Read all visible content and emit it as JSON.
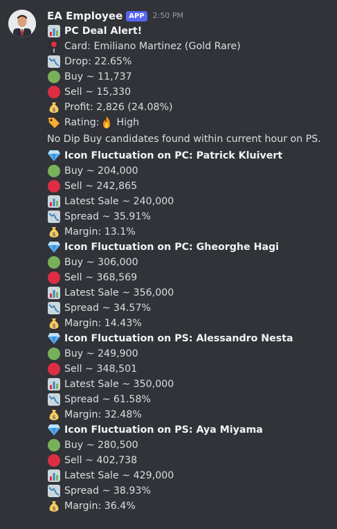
{
  "author": {
    "name": "EA Employee",
    "badge": "APP",
    "time": "2:50 PM"
  },
  "deal": {
    "title": "PC Deal Alert!",
    "lines": [
      {
        "icon": "pin-icon",
        "text": "Card: Emiliano Martinez (Gold Rare)"
      },
      {
        "icon": "chart-down-icon",
        "text": "Drop: 22.65%"
      },
      {
        "icon": "green-circle-icon",
        "text": "Buy ~ 11,737"
      },
      {
        "icon": "red-circle-icon",
        "text": "Sell ~ 15,330"
      },
      {
        "icon": "money-bag-icon",
        "text": "Profit: 2,826 (24.08%)"
      },
      {
        "icon": "tag-icon",
        "text": "Rating: ",
        "extra_icon": "fire-icon",
        "extra_text": " High"
      }
    ]
  },
  "note": "No Dip Buy candidates found within current hour on PS.",
  "fluctuations": [
    {
      "title": "Icon Fluctuation on PC: Patrick Kluivert",
      "buy": "Buy ~ 204,000",
      "sell": "Sell ~ 242,865",
      "latest": "Latest Sale ~ 240,000",
      "spread": "Spread ~ 35.91%",
      "margin": "Margin: 13.1%"
    },
    {
      "title": "Icon Fluctuation on PC: Gheorghe Hagi",
      "buy": "Buy ~ 306,000",
      "sell": "Sell ~ 368,569",
      "latest": "Latest Sale ~ 356,000",
      "spread": "Spread ~ 34.57%",
      "margin": "Margin: 14.43%"
    },
    {
      "title": "Icon Fluctuation on PS: Alessandro Nesta",
      "buy": "Buy ~ 249,900",
      "sell": "Sell ~ 348,501",
      "latest": "Latest Sale ~ 350,000",
      "spread": "Spread ~ 61.58%",
      "margin": "Margin: 32.48%"
    },
    {
      "title": "Icon Fluctuation on PS: Aya Miyama",
      "buy": "Buy ~ 280,500",
      "sell": "Sell ~ 402,738",
      "latest": "Latest Sale ~ 429,000",
      "spread": "Spread ~ 38.93%",
      "margin": "Margin: 36.4%"
    }
  ],
  "colors": {
    "background": "#313338",
    "text": "#dbdee1",
    "badge": "#5865f2",
    "green": "#78b159",
    "red": "#dd2e44"
  }
}
